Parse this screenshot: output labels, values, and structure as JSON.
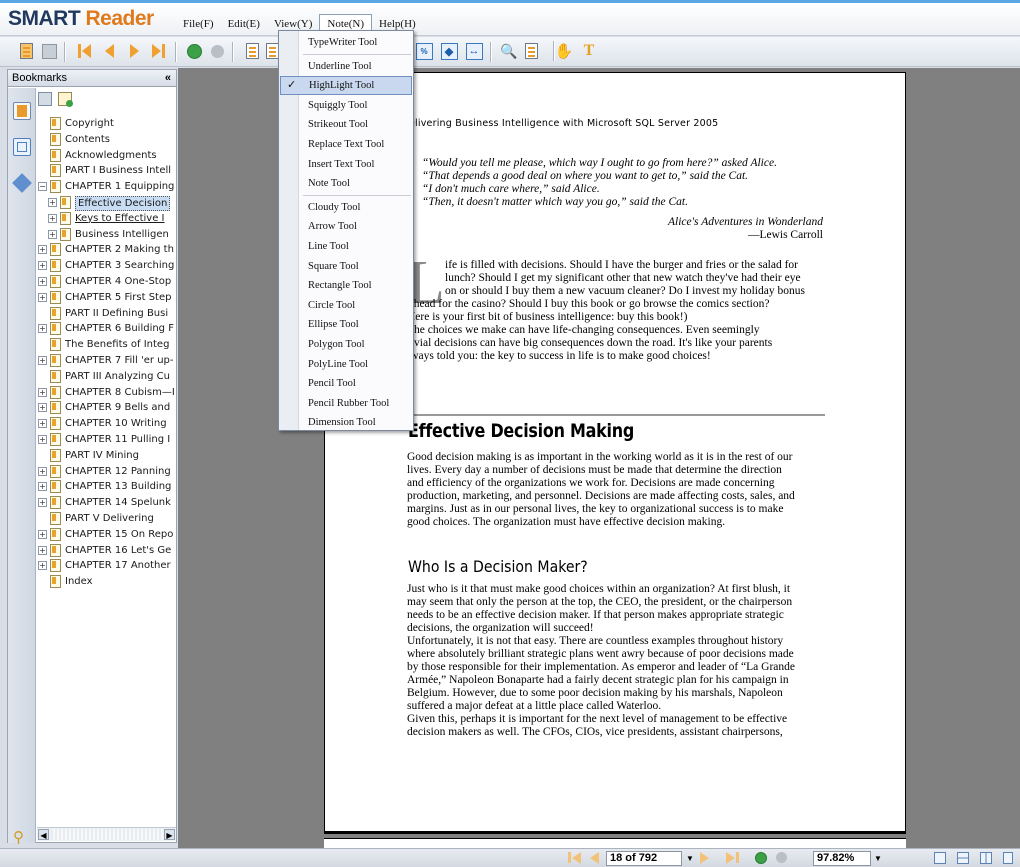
{
  "app": {
    "logo_smart": "SMART",
    "logo_reader": "Reader"
  },
  "menubar": {
    "items": [
      "File(F)",
      "Edit(E)",
      "View(Y)",
      "Note(N)",
      "Help(H)"
    ]
  },
  "note_menu": {
    "items": [
      {
        "label": "TypeWriter Tool"
      },
      {
        "label": "Underline Tool"
      },
      {
        "label": "HighLight Tool",
        "checked": true
      },
      {
        "label": "Squiggly Tool"
      },
      {
        "label": "Strikeout Tool"
      },
      {
        "label": "Replace Text Tool"
      },
      {
        "label": "Insert Text Tool"
      },
      {
        "label": "Note Tool"
      },
      {
        "label": "Cloudy Tool"
      },
      {
        "label": "Arrow Tool"
      },
      {
        "label": "Line Tool"
      },
      {
        "label": "Square Tool"
      },
      {
        "label": "Rectangle Tool"
      },
      {
        "label": "Circle Tool"
      },
      {
        "label": "Ellipse Tool"
      },
      {
        "label": "Polygon Tool"
      },
      {
        "label": "PolyLine Tool"
      },
      {
        "label": "Pencil Tool"
      },
      {
        "label": "Pencil Rubber Tool"
      },
      {
        "label": "Dimension Tool"
      }
    ],
    "check_glyph": "✓"
  },
  "bookmarks": {
    "title": "Bookmarks",
    "close_glyph": "«",
    "items": [
      {
        "label": "Copyright"
      },
      {
        "label": "Contents"
      },
      {
        "label": "Acknowledgments"
      },
      {
        "label": "PART I Business Intell"
      },
      {
        "label": "CHAPTER 1 Equipping"
      },
      {
        "label": "Effective Decision"
      },
      {
        "label": "Keys to Effective I"
      },
      {
        "label": "Business Intelligen"
      },
      {
        "label": "CHAPTER 2 Making th"
      },
      {
        "label": "CHAPTER 3 Searching"
      },
      {
        "label": "CHAPTER 4 One-Stop"
      },
      {
        "label": "CHAPTER 5 First Step"
      },
      {
        "label": "PART II Defining Busi"
      },
      {
        "label": "CHAPTER 6 Building F"
      },
      {
        "label": "The Benefits of Integ"
      },
      {
        "label": "CHAPTER 7 Fill 'er up-"
      },
      {
        "label": "PART III Analyzing Cu"
      },
      {
        "label": "CHAPTER 8 Cubism—I"
      },
      {
        "label": "CHAPTER 9 Bells and"
      },
      {
        "label": "CHAPTER 10 Writing"
      },
      {
        "label": "CHAPTER 11 Pulling I"
      },
      {
        "label": "PART IV Mining"
      },
      {
        "label": "CHAPTER 12 Panning"
      },
      {
        "label": "CHAPTER 13 Building"
      },
      {
        "label": "CHAPTER 14 Spelunk"
      },
      {
        "label": "PART V Delivering"
      },
      {
        "label": "CHAPTER 15 On Repo"
      },
      {
        "label": "CHAPTER 16 Let's Ge"
      },
      {
        "label": "CHAPTER 17 Another"
      },
      {
        "label": "Index"
      }
    ]
  },
  "document": {
    "running_head": "elivering Business Intelligence with Microsoft SQL Server 2005",
    "epigraph": [
      "“Would you tell me please, which way I ought to go from here?” asked Alice.",
      "“That depends a good deal on where you want to get to,” said the Cat.",
      "“I don't much care where,” said Alice.",
      "“Then, it doesn't matter which way you go,” said the Cat."
    ],
    "epigraph_source": "Alice's Adventures in Wonderland",
    "epigraph_author": "—Lewis Carroll",
    "dropcap": "L",
    "intro_lines": [
      "ife is filled with decisions. Should I have the burger and fries or the salad for",
      "lunch? Should I get my significant other that new watch they've had their eye",
      "on or should I buy them a new vacuum cleaner? Do I invest my holiday bonus",
      "r head for the casino? Should I buy this book or go browse the comics section?",
      "Here is your first bit of business intelligence: buy this book!)",
      "    The choices we make can have life-changing consequences. Even seemingly",
      "rivial decisions can have big consequences down the road. It's like your parents",
      "lways told you: the key to success in life is to make good choices!"
    ],
    "heading1": "Effective Decision Making",
    "para1_lines": [
      "Good decision making is as important in the working world as it is in the rest of our",
      "lives. Every day a number of decisions must be made that determine the direction",
      "and efficiency of the organizations we work for. Decisions are made concerning",
      "production, marketing, and personnel. Decisions are made affecting costs, sales, and",
      "margins. Just as in our personal lives, the key to organizational success is to make",
      "good choices. The organization must have effective decision making."
    ],
    "heading2": "Who Is a Decision Maker?",
    "para2_lines": [
      "Just who is it that must make good choices within an organization? At first blush, it",
      "may seem that only the person at the top, the CEO, the president, or the chairperson",
      "needs to be an effective decision maker. If that person makes appropriate strategic",
      "decisions, the organization will succeed!",
      "    Unfortunately, it is not that easy. There are countless examples throughout history",
      "where absolutely brilliant strategic plans went awry because of poor decisions made",
      "by those responsible for their implementation. As emperor and leader of “La Grande",
      "Armée,” Napoleon Bonaparte had a fairly decent strategic plan for his campaign in",
      "Belgium. However, due to some poor decision making by his marshals, Napoleon",
      "suffered a major defeat at a little place called Waterloo.",
      "    Given this, perhaps it is important for the next level of management to be effective",
      "decision makers as well. The CFOs, CIOs, vice presidents, assistant chairpersons,"
    ]
  },
  "status": {
    "page_indicator": "18 of 792",
    "zoom": "97.82%"
  }
}
